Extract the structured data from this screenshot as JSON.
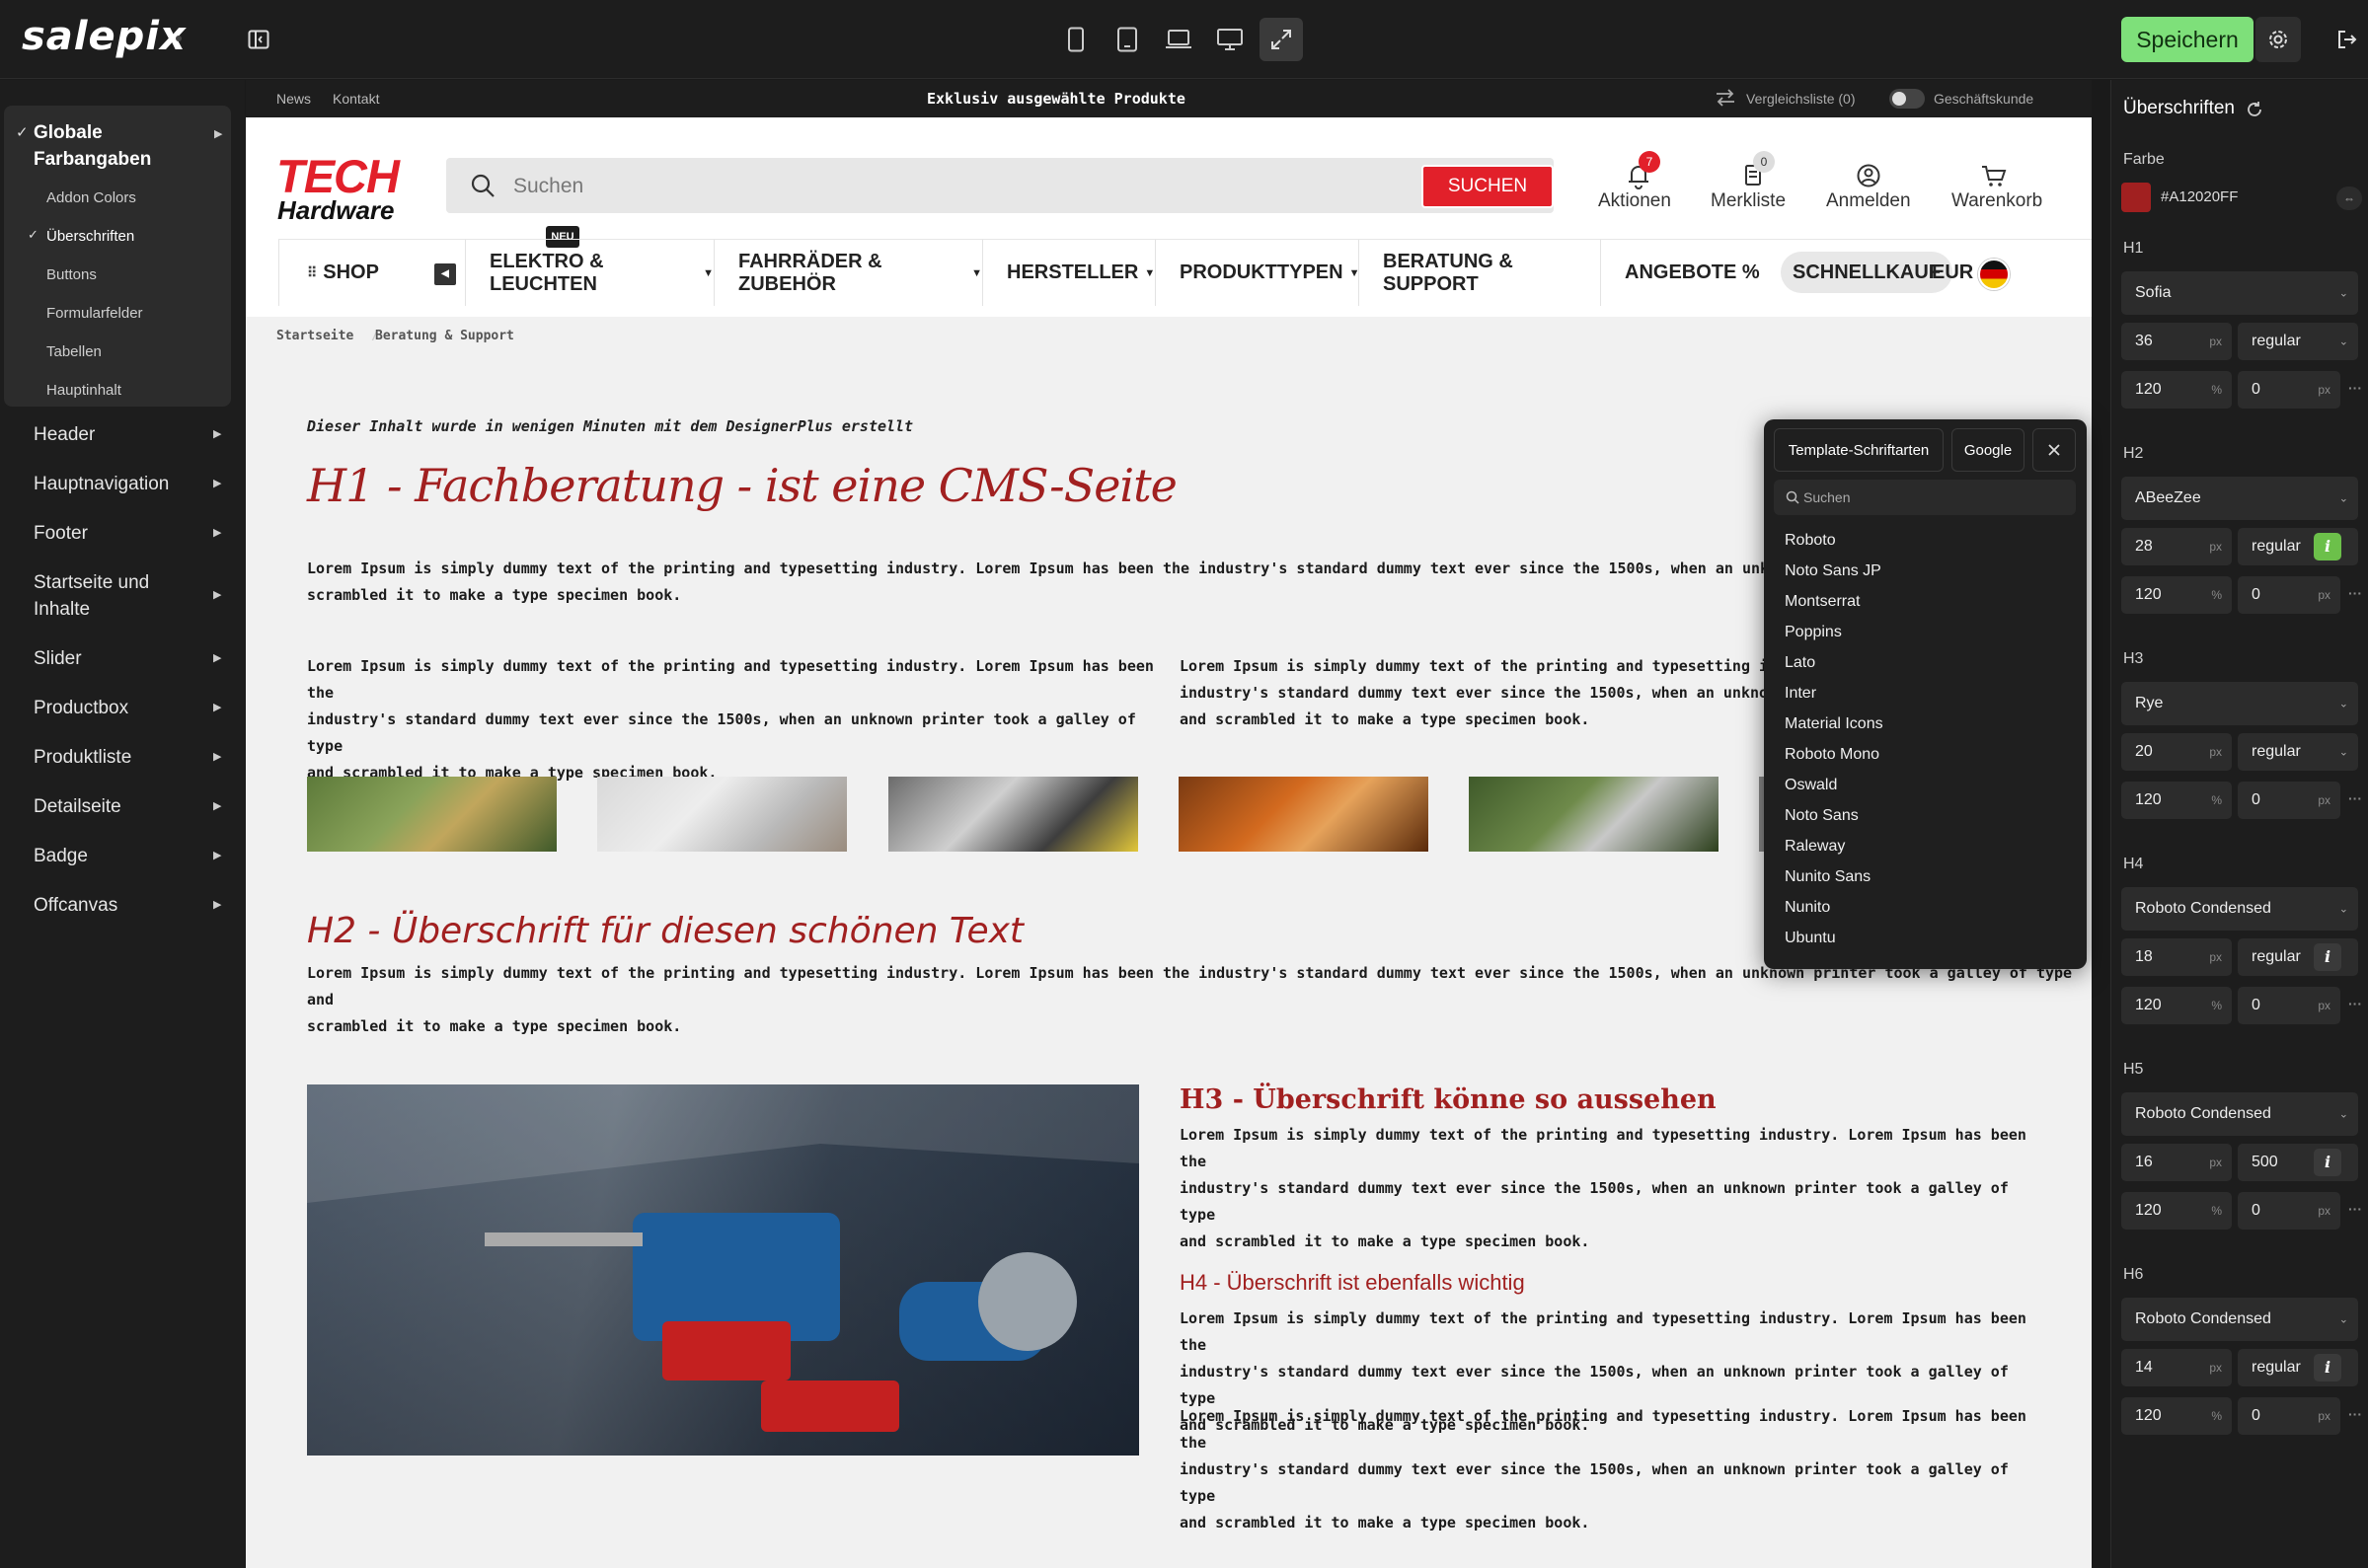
{
  "app": {
    "brand": "salepix",
    "save_label": "Speichern"
  },
  "sidebar": {
    "group_title": "Globale\nFarbangaben",
    "sub_items": [
      "Addon Colors",
      "Überschriften",
      "Buttons",
      "Formularfelder",
      "Tabellen",
      "Hauptinhalt"
    ],
    "active_sub": "Überschriften",
    "items": [
      "Header",
      "Hauptnavigation",
      "Footer",
      "Startseite und\nInhalte",
      "Slider",
      "Productbox",
      "Produktliste",
      "Detailseite",
      "Badge",
      "Offcanvas"
    ]
  },
  "shop": {
    "topstrip": {
      "news": "News",
      "kontakt": "Kontakt",
      "promo": "Exklusiv ausgewählte Produkte",
      "compare": "Vergleichsliste (0)",
      "business": "Geschäftskunde"
    },
    "brand_top": "TECH",
    "brand_bottom": "Hardware",
    "search_placeholder": "Suchen",
    "search_button": "SUCHEN",
    "header_icons": [
      {
        "label": "Aktionen",
        "badge": "7"
      },
      {
        "label": "Merkliste",
        "badge": "0"
      },
      {
        "label": "Anmelden"
      },
      {
        "label": "Warenkorb"
      }
    ],
    "nav": {
      "shop": "SHOP",
      "new_badge": "NEU",
      "items": [
        "ELEKTRO & LEUCHTEN",
        "FAHRRÄDER & ZUBEHÖR",
        "HERSTELLER",
        "PRODUKTTYPEN",
        "BERATUNG & SUPPORT",
        "ANGEBOTE %"
      ],
      "quick": "SCHNELLKAUF",
      "currency": "EUR"
    },
    "breadcrumb": [
      "Startseite",
      "Beratung & Support"
    ]
  },
  "page": {
    "intro": "Dieser Inhalt wurde in wenigen Minuten mit dem DesignerPlus erstellt",
    "h1": "H1 - Fachberatung - ist eine CMS-Seite",
    "p1": "Lorem Ipsum is simply dummy text of the printing and typesetting industry. Lorem Ipsum has been the industry's standard dummy text ever since the 1500s, when an unknown printer\nscrambled it to make a type specimen book.",
    "col_left": "Lorem Ipsum is simply dummy text of the printing and typesetting industry. Lorem Ipsum has been the\nindustry's standard dummy text ever since the 1500s, when an unknown printer took a galley of type\nand scrambled it to make a type specimen book.",
    "col_right": "Lorem Ipsum is simply dummy text of the printing and typesetting indust\nindustry's standard dummy text ever since the 1500s, when an unknown p\nand scrambled it to make a type specimen book.",
    "h2": "H2 - Überschrift für diesen schönen Text",
    "p2": "Lorem Ipsum is simply dummy text of the printing and typesetting industry. Lorem Ipsum has been the industry's standard dummy text ever since the 1500s, when an unknown printer took a galley of type and\nscrambled it to make a type specimen book.",
    "h3": "H3 - Überschrift könne so aussehen",
    "p3": "Lorem Ipsum is simply dummy text of the printing and typesetting industry. Lorem Ipsum has been the\nindustry's standard dummy text ever since the 1500s, when an unknown printer took a galley of type\nand scrambled it to make a type specimen book.",
    "h4": "H4 - Überschrift ist ebenfalls wichtig",
    "p4": "Lorem Ipsum is simply dummy text of the printing and typesetting industry. Lorem Ipsum has been the\nindustry's standard dummy text ever since the 1500s, when an unknown printer took a galley of type\nand scrambled it to make a type specimen book.",
    "p5": "Lorem Ipsum is simply dummy text of the printing and typesetting industry. Lorem Ipsum has been the\nindustry's standard dummy text ever since the 1500s, when an unknown printer took a galley of type\nand scrambled it to make a type specimen book."
  },
  "font_popup": {
    "tab_template": "Template-Schriftarten",
    "tab_google": "Google",
    "search_placeholder": "Suchen",
    "fonts": [
      "Roboto",
      "Noto Sans JP",
      "Montserrat",
      "Poppins",
      "Lato",
      "Inter",
      "Material Icons",
      "Roboto Mono",
      "Oswald",
      "Noto Sans",
      "Raleway",
      "Nunito Sans",
      "Nunito",
      "Ubuntu"
    ]
  },
  "panel": {
    "title": "Überschriften",
    "color_label": "Farbe",
    "color_hex": "#A12020FF",
    "headings": [
      {
        "label": "H1",
        "font": "Sofia",
        "size": "36",
        "weight": "regular",
        "line_height": "120",
        "spacing": "0"
      },
      {
        "label": "H2",
        "font": "ABeeZee",
        "size": "28",
        "weight": "regular",
        "line_height": "120",
        "spacing": "0",
        "italic": true
      },
      {
        "label": "H3",
        "font": "Rye",
        "size": "20",
        "weight": "regular",
        "line_height": "120",
        "spacing": "0"
      },
      {
        "label": "H4",
        "font": "Roboto Condensed",
        "size": "18",
        "weight": "regular",
        "line_height": "120",
        "spacing": "0"
      },
      {
        "label": "H5",
        "font": "Roboto Condensed",
        "size": "16",
        "weight": "500",
        "line_height": "120",
        "spacing": "0"
      },
      {
        "label": "H6",
        "font": "Roboto Condensed",
        "size": "14",
        "weight": "regular",
        "line_height": "120",
        "spacing": "0"
      }
    ],
    "unit_px": "px",
    "unit_pct": "%",
    "italic_glyph": "i"
  },
  "colors": {
    "accent": "#A12020",
    "brand_red": "#E2202A",
    "save_green": "#7EE07A",
    "dark_bg": "#1D1D1D"
  }
}
